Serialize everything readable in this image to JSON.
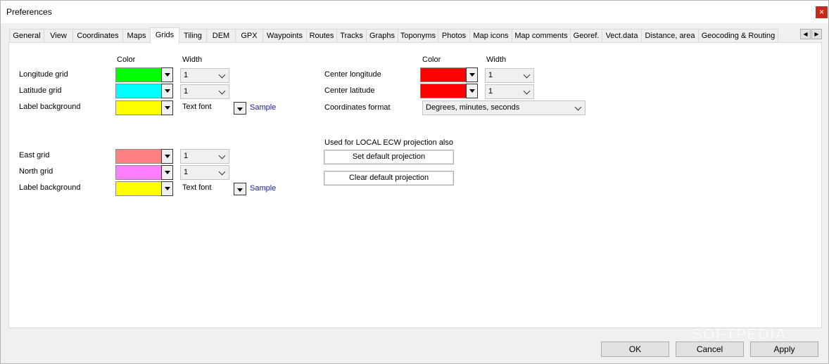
{
  "window": {
    "title": "Preferences",
    "close_glyph": "×"
  },
  "tabs": [
    "General",
    "View",
    "Coordinates",
    "Maps",
    "Grids",
    "Tiling",
    "DEM",
    "GPX",
    "Waypoints",
    "Routes",
    "Tracks",
    "Graphs",
    "Toponyms",
    "Photos",
    "Map icons",
    "Map comments",
    "Georef.",
    "Vect.data",
    "Distance, area",
    "Geocoding & Routing"
  ],
  "active_tab": "Grids",
  "tab_scroll": {
    "left": "◀",
    "right": "▶"
  },
  "geo": {
    "color_header": "Color",
    "width_header": "Width",
    "rows": [
      {
        "label": "Longitude grid",
        "color": "#00ff00",
        "width": "1"
      },
      {
        "label": "Latitude grid",
        "color": "#00ffff",
        "width": "1"
      }
    ],
    "label_bg": {
      "label": "Label background",
      "color": "#ffff00",
      "text_font": "Text font",
      "sample": "Sample"
    }
  },
  "proj": {
    "rows": [
      {
        "label": "East grid",
        "color": "#ff8080",
        "width": "1"
      },
      {
        "label": "North grid",
        "color": "#ff80ff",
        "width": "1"
      }
    ],
    "label_bg": {
      "label": "Label background",
      "color": "#ffff00",
      "text_font": "Text font",
      "sample": "Sample"
    }
  },
  "center": {
    "color_header": "Color",
    "width_header": "Width",
    "rows": [
      {
        "label": "Center longitude",
        "color": "#ff0000",
        "width": "1"
      },
      {
        "label": "Center latitude",
        "color": "#ff0000",
        "width": "1"
      }
    ],
    "coords_format_label": "Coordinates format",
    "coords_format_value": "Degrees, minutes, seconds"
  },
  "local_ecw": {
    "caption": "Used for LOCAL ECW projection also",
    "set_button": "Set default projection",
    "clear_button": "Clear default projection"
  },
  "footer": {
    "ok": "OK",
    "cancel": "Cancel",
    "apply": "Apply"
  },
  "watermark": "SOFTPEDIA"
}
